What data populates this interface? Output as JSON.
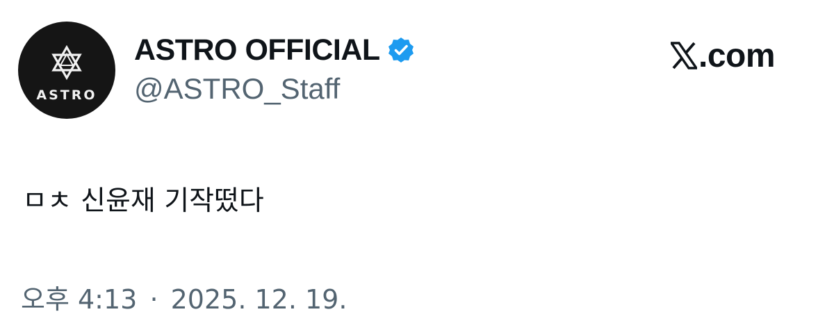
{
  "author": {
    "avatar_text": "ASTRO",
    "display_name": "ASTRO OFFICIAL",
    "handle": "@ASTRO_Staff",
    "verified": true,
    "verified_color": "#1d9bf0"
  },
  "brand": {
    "logo_text": ".com",
    "icon": "x-logo-icon"
  },
  "tweet": {
    "text": "ㅁㅊ 신윤재 기작떴다",
    "time": "오후 4:13",
    "separator": "·",
    "date": "2025. 12. 19."
  },
  "colors": {
    "primary_text": "#0f1419",
    "secondary_text": "#536471",
    "avatar_bg": "#151515"
  }
}
